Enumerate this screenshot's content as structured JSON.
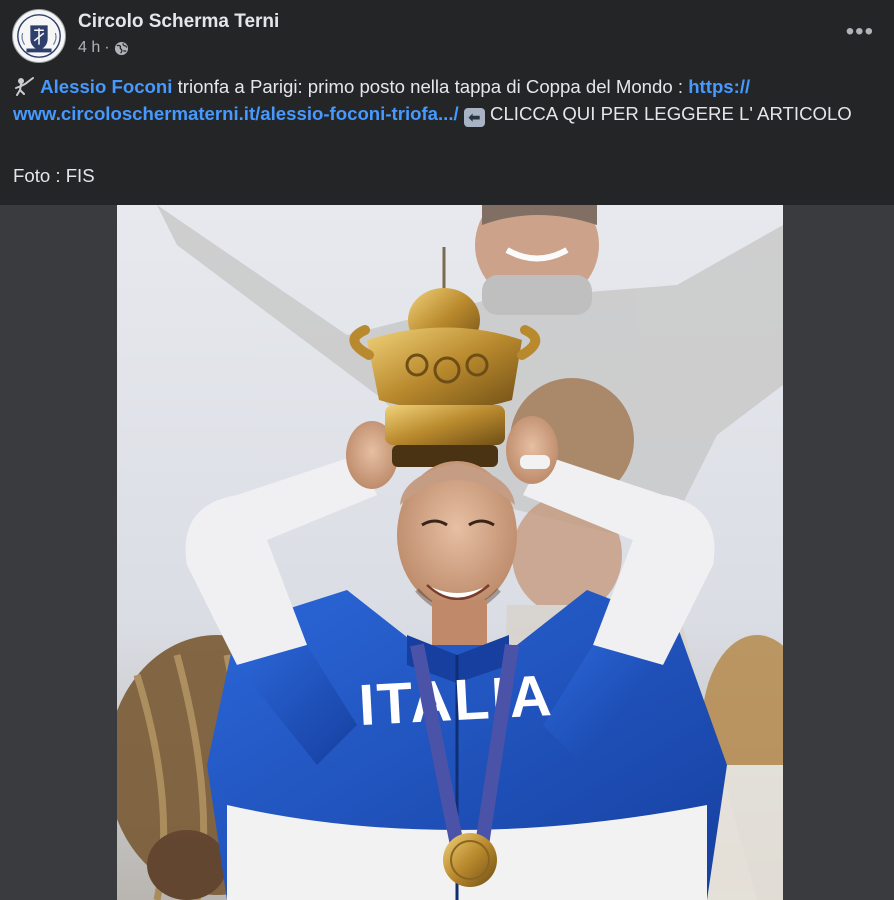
{
  "header": {
    "page_name": "Circolo Scherma Terni",
    "time": "4 h",
    "separator": "·",
    "more_label": "•••"
  },
  "post": {
    "mention": "Alessio Foconi",
    "text_1": " trionfa a Parigi: primo posto nella tappa di Coppa del Mondo : ",
    "link": "https:// www.circoloschermaterni.it/alessio-foconi-triofa.../",
    "arrow_emoji": "⬅",
    "text_2": " CLICCA QUI PER LEGGERE L' ARTICOLO",
    "credit": "Foto : FIS"
  },
  "photo": {
    "jacket_text": "ITALIA"
  },
  "icons": {
    "avatar": "club-crest-icon",
    "fencer": "fencer-emoji-icon",
    "visibility": "globe-icon",
    "more": "more-options-icon"
  },
  "colors": {
    "background": "#242526",
    "media_background": "#3a3b3e",
    "link": "#4599ff",
    "text": "#e4e6eb",
    "secondary_text": "#b0b3b8",
    "jacket_blue": "#1f56c9"
  }
}
